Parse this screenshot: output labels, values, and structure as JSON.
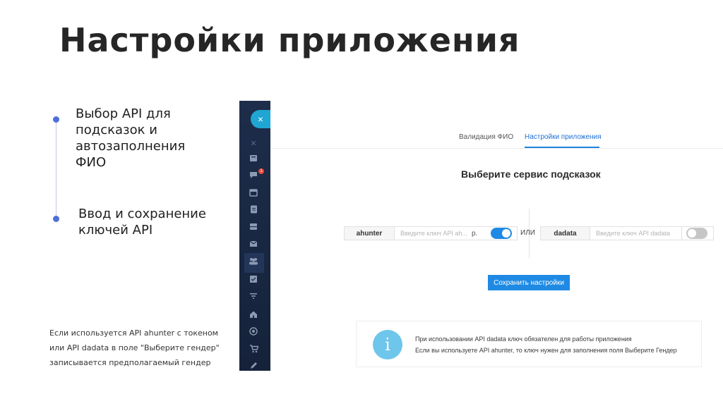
{
  "slide": {
    "title": "Настройки приложения",
    "bullets": [
      "Выбор API для подсказок и автозаполнения ФИО",
      "Ввод и сохранение ключей API"
    ],
    "bullet_lines": [
      [
        "Выбор API для",
        "подсказок и",
        "автозаполнения",
        "ФИО"
      ],
      [
        "Ввод и сохранение",
        "ключей API"
      ]
    ],
    "note_lines": [
      "Если используется API ahunter с токеном",
      "или API dadata в поле \"Выберите гендер\"",
      "записывается предполагаемый гендер"
    ]
  },
  "sidebar": {
    "close_glyph": "×",
    "badge_count": "1",
    "icons": [
      "close-icon",
      "close-icon",
      "list-icon",
      "chat-icon",
      "calendar-icon",
      "document-icon",
      "inbox-icon",
      "mail-icon",
      "users-icon",
      "checklist-icon",
      "filter-icon",
      "home-icon",
      "target-icon",
      "cart-icon",
      "pen-icon"
    ]
  },
  "app": {
    "tabs": [
      {
        "label": "Валидация ФИО",
        "active": false
      },
      {
        "label": "Настройки приложения",
        "active": true
      }
    ],
    "section_title": "Выберите сервис подсказок",
    "or_label": "ИЛИ",
    "api_left": {
      "name": "ahunter",
      "placeholder": "Введите ключ API ah...",
      "suffix": "р.",
      "enabled": true
    },
    "api_right": {
      "name": "dadata",
      "placeholder": "Введите ключ API dadata",
      "enabled": false
    },
    "save_label": "Сохранить настройки",
    "info_icon_glyph": "i",
    "info_lines": [
      "При использовании API dadata ключ обязателен для работы приложения",
      "Если вы используете API ahunter, то ключ нужен для заполнения поля Выберите Гендер"
    ]
  },
  "colors": {
    "accent": "#1f8ae4",
    "toggle_on": "#1f8ae4",
    "toggle_off": "#c6c6c6",
    "sidebar_bg": "#1d2d4a",
    "sidebar_button": "#1fa6d3",
    "info_icon": "#6ec6ea",
    "timeline_dot": "#4d6fd8"
  }
}
